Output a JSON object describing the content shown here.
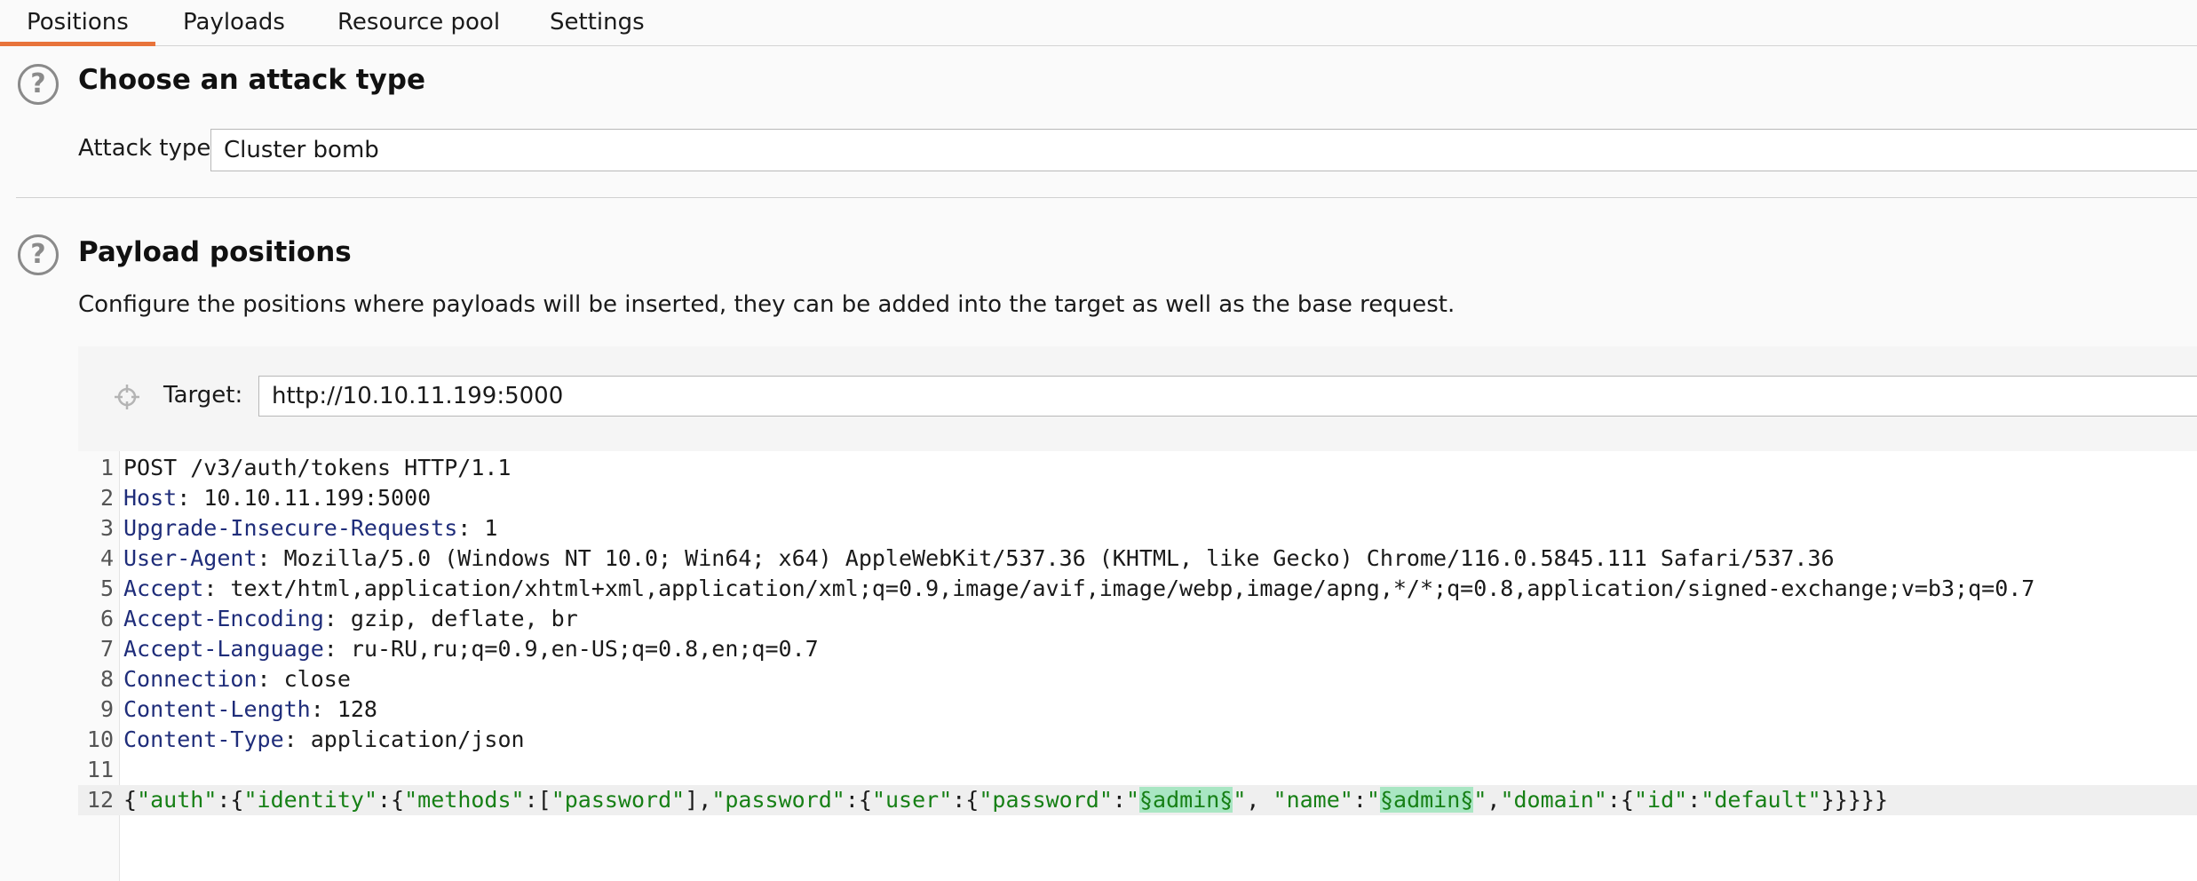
{
  "tabs": [
    {
      "label": "Positions",
      "active": true
    },
    {
      "label": "Payloads",
      "active": false
    },
    {
      "label": "Resource pool",
      "active": false
    },
    {
      "label": "Settings",
      "active": false
    }
  ],
  "attack_section": {
    "title": "Choose an attack type",
    "attack_type_label": "Attack type:",
    "attack_type_value": "Cluster bomb"
  },
  "payload_section": {
    "title": "Payload positions",
    "description": "Configure the positions where payloads will be inserted, they can be added into the target as well as the base request.",
    "target_label": "Target:",
    "target_value": "http://10.10.11.199:5000"
  },
  "request": {
    "request_line": "POST /v3/auth/tokens HTTP/1.1",
    "headers": [
      {
        "name": "Host",
        "value": "10.10.11.199:5000"
      },
      {
        "name": "Upgrade-Insecure-Requests",
        "value": "1"
      },
      {
        "name": "User-Agent",
        "value": "Mozilla/5.0 (Windows NT 10.0; Win64; x64) AppleWebKit/537.36 (KHTML, like Gecko) Chrome/116.0.5845.111 Safari/537.36"
      },
      {
        "name": "Accept",
        "value": "text/html,application/xhtml+xml,application/xml;q=0.9,image/avif,image/webp,image/apng,*/*;q=0.8,application/signed-exchange;v=b3;q=0.7"
      },
      {
        "name": "Accept-Encoding",
        "value": "gzip, deflate, br"
      },
      {
        "name": "Accept-Language",
        "value": "ru-RU,ru;q=0.9,en-US;q=0.8,en;q=0.7"
      },
      {
        "name": "Connection",
        "value": "close"
      },
      {
        "name": "Content-Length",
        "value": "128"
      },
      {
        "name": "Content-Type",
        "value": "application/json"
      }
    ],
    "line_numbers": [
      "1",
      "2",
      "3",
      "4",
      "5",
      "6",
      "7",
      "8",
      "9",
      "10",
      "11",
      "12"
    ],
    "body_tokens": [
      {
        "t": "{",
        "k": "p"
      },
      {
        "t": "\"auth\"",
        "k": "s"
      },
      {
        "t": ":{",
        "k": "p"
      },
      {
        "t": "\"identity\"",
        "k": "s"
      },
      {
        "t": ":{",
        "k": "p"
      },
      {
        "t": "\"methods\"",
        "k": "s"
      },
      {
        "t": ":[",
        "k": "p"
      },
      {
        "t": "\"password\"",
        "k": "s"
      },
      {
        "t": "],",
        "k": "p"
      },
      {
        "t": "\"password\"",
        "k": "s"
      },
      {
        "t": ":{",
        "k": "p"
      },
      {
        "t": "\"user\"",
        "k": "s"
      },
      {
        "t": ":{",
        "k": "p"
      },
      {
        "t": "\"password\"",
        "k": "s"
      },
      {
        "t": ":",
        "k": "p"
      },
      {
        "t": "\"",
        "k": "s"
      },
      {
        "t": "§admin§",
        "k": "m"
      },
      {
        "t": "\"",
        "k": "s"
      },
      {
        "t": ", ",
        "k": "p"
      },
      {
        "t": "\"name\"",
        "k": "s"
      },
      {
        "t": ":",
        "k": "p"
      },
      {
        "t": "\"",
        "k": "s"
      },
      {
        "t": "§admin§",
        "k": "m"
      },
      {
        "t": "\"",
        "k": "s"
      },
      {
        "t": ",",
        "k": "p"
      },
      {
        "t": "\"domain\"",
        "k": "s"
      },
      {
        "t": ":{",
        "k": "p"
      },
      {
        "t": "\"id\"",
        "k": "s"
      },
      {
        "t": ":",
        "k": "p"
      },
      {
        "t": "\"default\"",
        "k": "s"
      },
      {
        "t": "}}}}}",
        "k": "p"
      }
    ]
  },
  "icons": {
    "help": "question-mark-icon",
    "target": "crosshair-icon"
  },
  "colors": {
    "active_tab_underline": "#e8743b",
    "header_name": "#1f2d7a",
    "json_string": "#178016",
    "payload_marker_bg": "#a9e6c3"
  }
}
